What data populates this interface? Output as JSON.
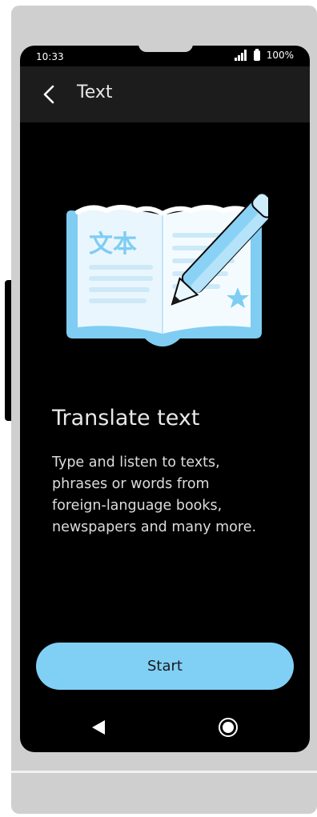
{
  "status_bar": {
    "time": "10:33",
    "battery": "100%"
  },
  "app_bar": {
    "title": "Text"
  },
  "illustration": {
    "glyphs": "文本"
  },
  "content": {
    "headline": "Translate text",
    "description": "Type and listen to texts,\nphrases or words from\nforeign-language books,\nnewspapers and many more."
  },
  "actions": {
    "start_label": "Start"
  },
  "colors": {
    "accent": "#80d0f6",
    "screen_bg": "#000000",
    "app_bar_bg": "#1c1c1c",
    "device_frame": "#cfcfcf"
  }
}
